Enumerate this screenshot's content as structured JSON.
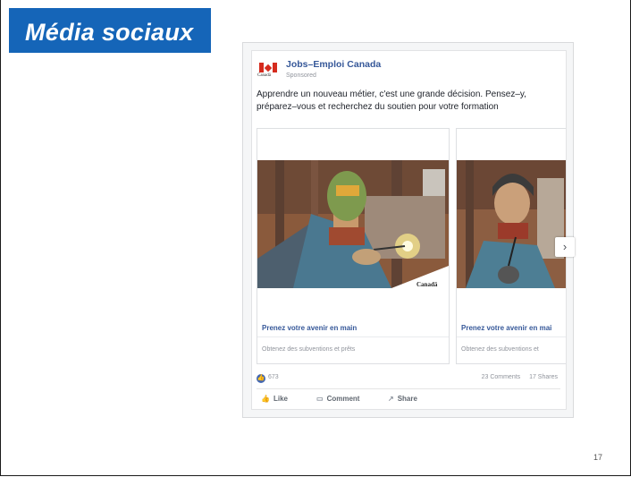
{
  "slide": {
    "title": "Média sociaux",
    "page_number": "17"
  },
  "post": {
    "page_name": "Jobs–Emploi Canada",
    "sponsored_label": "Sponsored",
    "flag_wordmark": "Canadä",
    "text": "Apprendre un nouveau métier, c'est une grande décision. Pensez–y, préparez–vous et recherchez du soutien pour votre formation",
    "cards": [
      {
        "title": "Prenez votre avenir en main",
        "subtitle": "Obtenez des subventions et prêts",
        "wordmark": "Canadä"
      },
      {
        "title": "Prenez votre avenir en mai",
        "subtitle": "Obtenez des subventions et"
      }
    ],
    "next_arrow": "›",
    "reactions": {
      "like_count": "673",
      "comments": "23 Comments",
      "shares": "17 Shares"
    },
    "actions": {
      "like": "Like",
      "comment": "Comment",
      "share": "Share"
    }
  },
  "colors": {
    "title_bg": "#1565b8",
    "facebook_blue": "#365899",
    "canada_red": "#d52b1e"
  }
}
